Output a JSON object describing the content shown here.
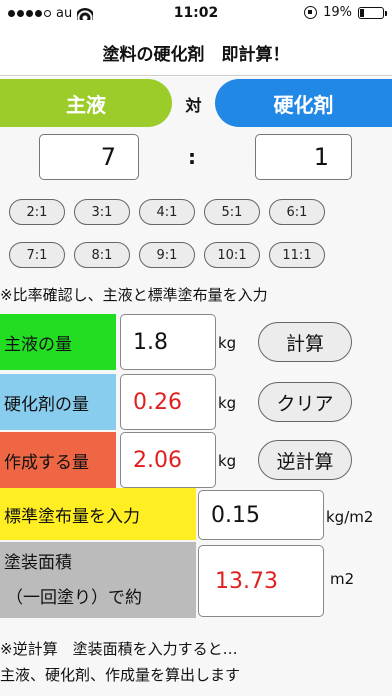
{
  "status_bar": {
    "carrier": "au",
    "time": "11:02",
    "battery": "19%",
    "battery_level": 0.19
  },
  "header": {
    "title": "塗料の硬化剤　即計算！"
  },
  "selector": {
    "main_label": "主液",
    "vs_label": "対",
    "hardener_label": "硬化剤"
  },
  "ratio": {
    "main_value": "7",
    "colon": ":",
    "hardener_value": "1"
  },
  "presets": [
    "2:1",
    "3:1",
    "4:1",
    "5:1",
    "6:1",
    "7:1",
    "8:1",
    "9:1",
    "10:1",
    "11:1"
  ],
  "note_top": "※比率確認し、主液と標準塗布量を入力",
  "rows": {
    "main": {
      "label": "主液の量",
      "value": "1.8",
      "unit": "kg",
      "button": "計算"
    },
    "hardener": {
      "label": "硬化剤の量",
      "value": "0.26",
      "unit": "kg",
      "button": "クリア"
    },
    "total": {
      "label": "作成する量",
      "value": "2.06",
      "unit": "kg",
      "button": "逆計算"
    },
    "coverage": {
      "label": "標準塗布量を入力",
      "value": "0.15",
      "unit": "kg/m2"
    },
    "area": {
      "label_line1": "塗装面積",
      "label_line2": "（一回塗り）で約",
      "value": "13.73",
      "unit": "m2"
    }
  },
  "note_bottom_1": "※逆計算　塗装面積を入力すると…",
  "note_bottom_2": "主液、硬化剤、作成量を算出します",
  "colors": {
    "main_green": "#9ccc2a",
    "hardener_blue": "#2288e6",
    "row_green": "#22dd22",
    "row_blue": "#88ccee",
    "row_orange": "#ee6644",
    "row_yellow": "#ffee22",
    "row_gray": "#bbbbbb",
    "value_red": "#e02020"
  },
  "icons": [
    "signal-dots-icon",
    "wifi-icon",
    "rotation-lock-icon",
    "battery-icon"
  ]
}
